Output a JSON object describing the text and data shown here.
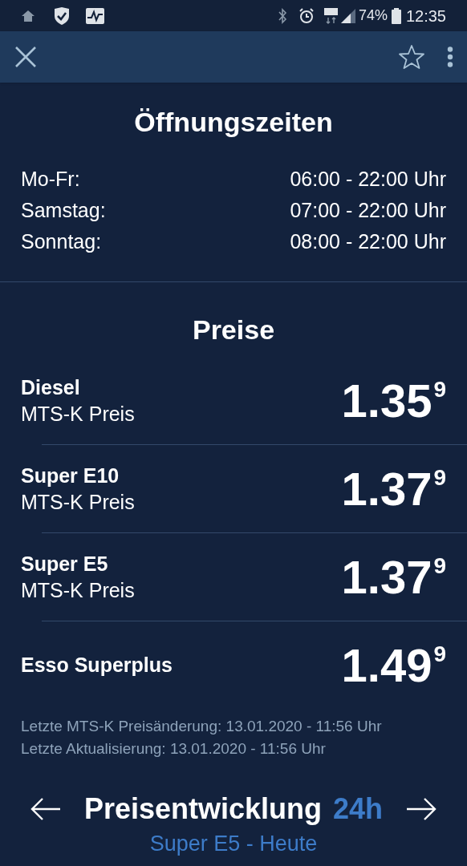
{
  "status_bar": {
    "battery": "74%",
    "time": "12:35"
  },
  "hours": {
    "title": "Öffnungszeiten",
    "rows": [
      {
        "day": "Mo-Fr:",
        "time": "06:00 - 22:00 Uhr"
      },
      {
        "day": "Samstag:",
        "time": "07:00 - 22:00 Uhr"
      },
      {
        "day": "Sonntag:",
        "time": "08:00 - 22:00 Uhr"
      }
    ]
  },
  "prices": {
    "title": "Preise",
    "rows": [
      {
        "fuel": "Diesel",
        "source": "MTS-K Preis",
        "price": "1.35",
        "price_digit": "9"
      },
      {
        "fuel": "Super E10",
        "source": "MTS-K Preis",
        "price": "1.37",
        "price_digit": "9"
      },
      {
        "fuel": "Super E5",
        "source": "MTS-K Preis",
        "price": "1.37",
        "price_digit": "9"
      },
      {
        "fuel": "Esso Superplus",
        "price": "1.49",
        "price_digit": "9"
      }
    ],
    "notes": [
      "Letzte MTS-K Preisänderung: 13.01.2020 - 11:56 Uhr",
      "Letzte Aktualisierung: 13.01.2020 - 11:56 Uhr"
    ]
  },
  "trend": {
    "title": "Preisentwicklung",
    "period": "24h",
    "subtitle": "Super E5 - Heute"
  }
}
